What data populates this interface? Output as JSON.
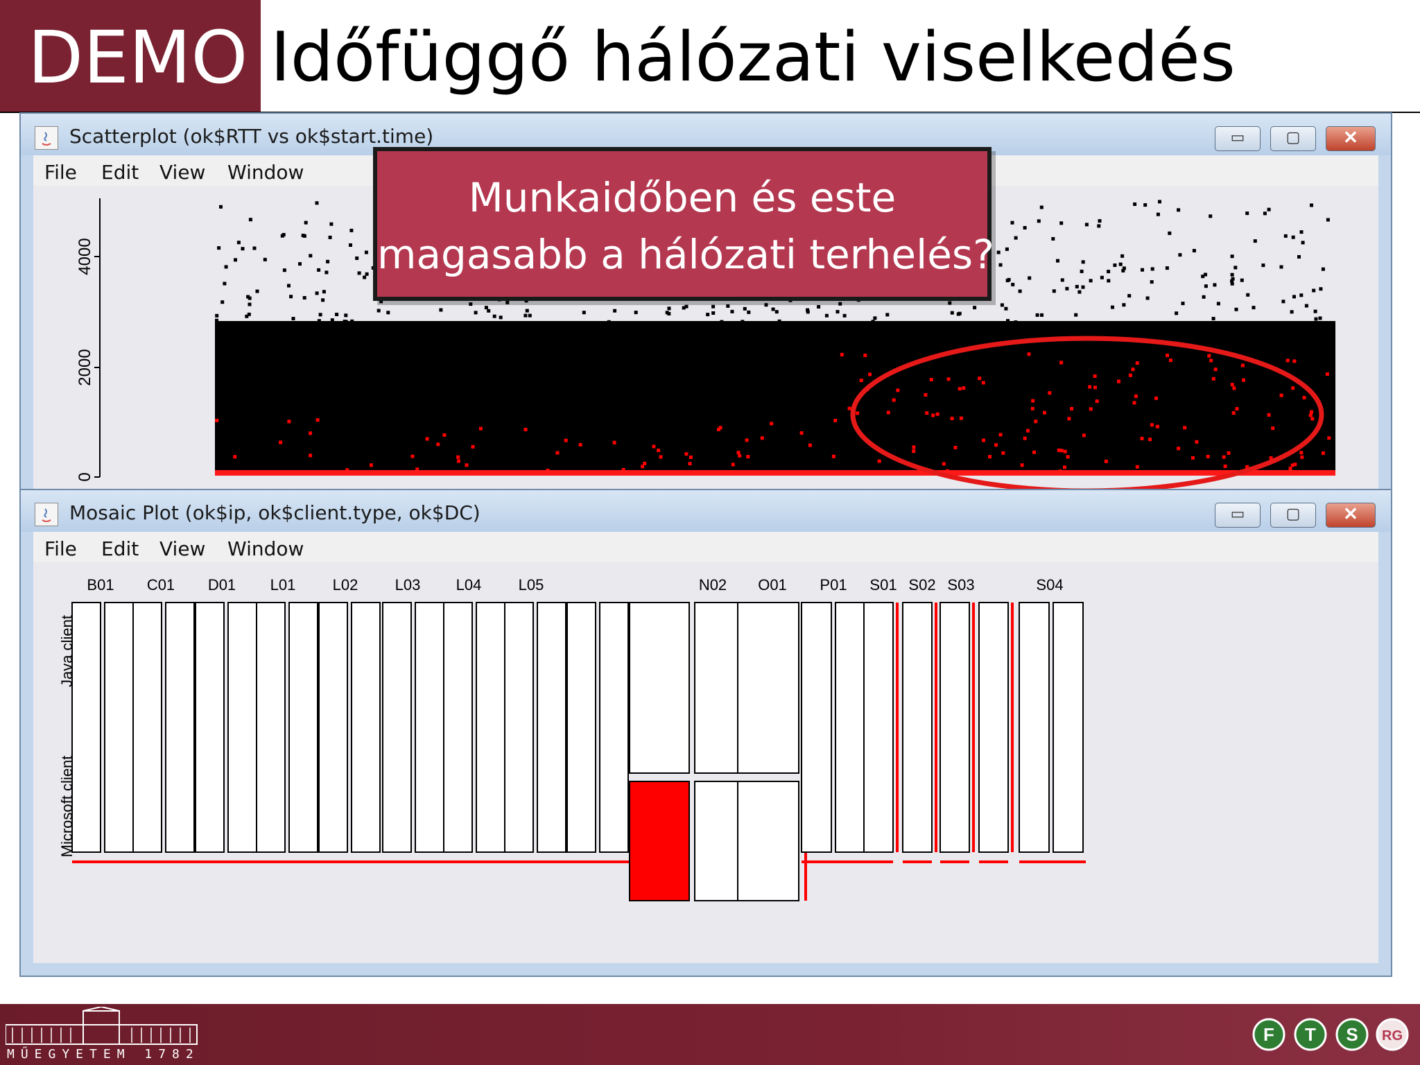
{
  "slide": {
    "badge": "DEMO",
    "title": "Időfüggő hálózati viselkedés"
  },
  "callout": {
    "line1": "Munkaidőben és este",
    "line2": "magasabb a hálózati terhelés?"
  },
  "scatter_window": {
    "title": "Scatterplot (ok$RTT vs ok$start.time)",
    "menu": [
      "File",
      "Edit",
      "View",
      "Window"
    ],
    "controls": {
      "minimize": "▭",
      "maximize": "▢",
      "close": "✕"
    }
  },
  "mosaic_window": {
    "title": "Mosaic Plot (ok$ip, ok$client.type, ok$DC)",
    "menu": [
      "File",
      "Edit",
      "View",
      "Window"
    ],
    "controls": {
      "minimize": "▭",
      "maximize": "▢",
      "close": "✕"
    }
  },
  "footer": {
    "caption": "MŰEGYETEM 1782",
    "logo_letters": [
      "F",
      "T",
      "S",
      "RG"
    ]
  },
  "colors": {
    "brand": "#7a2232",
    "callout": "#b43850",
    "highlight": "#ff0000",
    "points": "#000000"
  },
  "chart_data": [
    {
      "type": "scatter",
      "title": "",
      "xlabel": "",
      "ylabel": "",
      "x_axis": "start.time",
      "y_axis": "RTT",
      "ylim": [
        0,
        4500
      ],
      "yticks": [
        "0",
        "2000",
        "4000"
      ],
      "series": [
        {
          "name": "",
          "color": "#000000",
          "note_values": "dense cloud, mostly 0–1500"
        },
        {
          "name": "",
          "color": "#ff0000"
        }
      ],
      "annotation": "ellipse around later period"
    },
    {
      "type": "mosaic",
      "categories": [
        "B01",
        "C01",
        "D01",
        "L01",
        "L02",
        "L03",
        "L04",
        "L05",
        "",
        "N02",
        "O01",
        "P01",
        "S01",
        "S02",
        "S03",
        "S04"
      ],
      "row_labels": [
        "Java client",
        "Microsoft client"
      ],
      "highlighted": [
        "N02 Microsoft client"
      ]
    }
  ]
}
